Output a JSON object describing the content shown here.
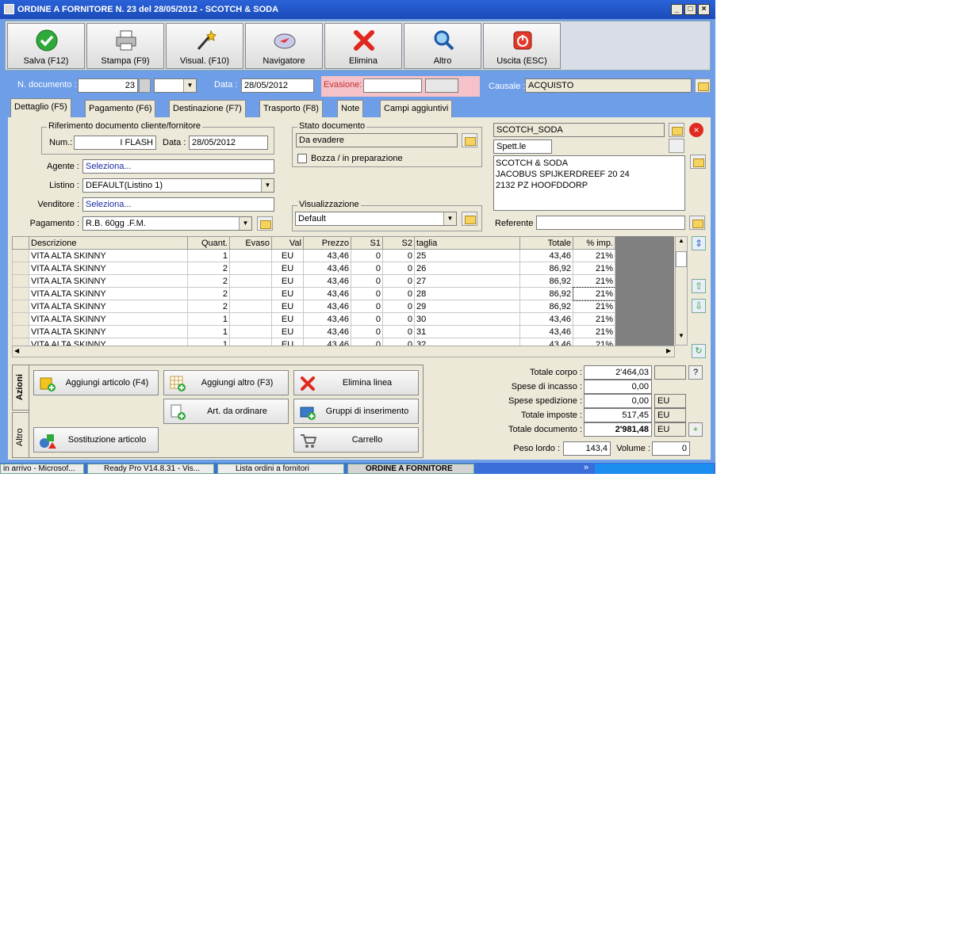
{
  "window": {
    "title": "ORDINE A FORNITORE N. 23  del 28/05/2012 - SCOTCH & SODA"
  },
  "toolbar": [
    {
      "label": "Salva (F12)",
      "icon": "check-icon"
    },
    {
      "label": "Stampa (F9)",
      "icon": "printer-icon"
    },
    {
      "label": "Visual. (F10)",
      "icon": "wand-icon"
    },
    {
      "label": "Navigatore",
      "icon": "compass-icon"
    },
    {
      "label": "Elimina",
      "icon": "delete-x-icon"
    },
    {
      "label": "Altro",
      "icon": "search-icon"
    },
    {
      "label": "Uscita (ESC)",
      "icon": "power-icon"
    }
  ],
  "header": {
    "ndoc_label": "N. documento :",
    "ndoc_value": "23",
    "data_label": "Data :",
    "data_value": "28/05/2012",
    "evasione_label": "Evasione:",
    "evasione_value": "",
    "causale_label": "Causale :",
    "causale_value": "ACQUISTO"
  },
  "tabs": [
    "Dettaglio (F5)",
    "Pagamento (F6)",
    "Destinazione (F7)",
    "Trasporto (F8)",
    "Note",
    "Campi aggiuntivi"
  ],
  "riferimento": {
    "legend": "Riferimento documento cliente/fornitore",
    "num_label": "Num.:",
    "num_value": "I FLASH",
    "data_label": "Data :",
    "data_value": "28/05/2012"
  },
  "form": {
    "agente_label": "Agente :",
    "agente_value": "Seleziona...",
    "listino_label": "Listino :",
    "listino_value": "DEFAULT(Listino 1)",
    "venditore_label": "Venditore :",
    "venditore_value": "Seleziona...",
    "pagamento_label": "Pagamento :",
    "pagamento_value": "R.B. 60gg .F.M."
  },
  "stato": {
    "legend": "Stato documento",
    "value": "Da evadere",
    "bozza_label": "Bozza / in preparazione"
  },
  "visualizzazione": {
    "legend": "Visualizzazione",
    "value": "Default"
  },
  "fornitore": {
    "code": "SCOTCH_SODA",
    "title": "Spett.le",
    "address": [
      "SCOTCH & SODA",
      "JACOBUS SPIJKERDREEF 20 24",
      "2132 PZ HOOFDDORP"
    ],
    "referente_label": "Referente",
    "referente_value": ""
  },
  "grid": {
    "columns": [
      "Descrizione",
      "Quant.",
      "Evaso",
      "Val",
      "Prezzo",
      "S1",
      "S2",
      "taglia",
      "Totale",
      "% imp."
    ],
    "rows": [
      [
        "VITA ALTA SKINNY",
        "1",
        "",
        "EU",
        "43,46",
        "0",
        "0",
        "25",
        "43,46",
        "21%"
      ],
      [
        "VITA ALTA SKINNY",
        "2",
        "",
        "EU",
        "43,46",
        "0",
        "0",
        "26",
        "86,92",
        "21%"
      ],
      [
        "VITA ALTA SKINNY",
        "2",
        "",
        "EU",
        "43,46",
        "0",
        "0",
        "27",
        "86,92",
        "21%"
      ],
      [
        "VITA ALTA SKINNY",
        "2",
        "",
        "EU",
        "43,46",
        "0",
        "0",
        "28",
        "86,92",
        "21%"
      ],
      [
        "VITA ALTA SKINNY",
        "2",
        "",
        "EU",
        "43,46",
        "0",
        "0",
        "29",
        "86,92",
        "21%"
      ],
      [
        "VITA ALTA SKINNY",
        "1",
        "",
        "EU",
        "43,46",
        "0",
        "0",
        "30",
        "43,46",
        "21%"
      ],
      [
        "VITA ALTA SKINNY",
        "1",
        "",
        "EU",
        "43,46",
        "0",
        "0",
        "31",
        "43,46",
        "21%"
      ],
      [
        "VITA ALTA SKINNY",
        "1",
        "",
        "EU",
        "43,46",
        "0",
        "0",
        "32",
        "43,46",
        "21%"
      ]
    ]
  },
  "side_tabs": [
    "Azioni",
    "Altro"
  ],
  "actions": [
    {
      "label": "Aggiungi articolo (F4)",
      "icon": "box-add-icon"
    },
    {
      "label": "Aggiungi altro (F3)",
      "icon": "grid-add-icon"
    },
    {
      "label": "Elimina linea",
      "icon": "delete-x-icon"
    },
    {
      "label": "Art. da ordinare",
      "icon": "doc-add-icon"
    },
    {
      "label": "Gruppi di inserimento",
      "icon": "group-add-icon"
    },
    {
      "label": "Sostituzione articolo",
      "icon": "shapes-icon"
    },
    {
      "label": "Carrello",
      "icon": "cart-icon"
    }
  ],
  "totals": {
    "corpo_label": "Totale corpo :",
    "corpo_value": "2'464,03",
    "incasso_label": "Spese di incasso :",
    "incasso_value": "0,00",
    "spedizione_label": "Spese spedizione :",
    "spedizione_value": "0,00",
    "spedizione_cur": "EU",
    "imposte_label": "Totale imposte :",
    "imposte_value": "517,45",
    "imposte_cur": "EU",
    "documento_label": "Totale documento :",
    "documento_value": "2'981,48",
    "documento_cur": "EU",
    "peso_label": "Peso lordo :",
    "peso_value": "143,4",
    "volume_label": "Volume :",
    "volume_value": "0",
    "help": "?"
  },
  "taskbar": [
    "in arrivo - Microsof...",
    "Ready Pro V14.8.31 - Vis...",
    "Lista ordini a fornitori",
    "ORDINE A FORNITORE"
  ],
  "colors": {
    "titlebar": "#1b4bb8",
    "background": "#6f9ee8",
    "panel": "#ece9d8",
    "evasione_bg": "#f4c2c8"
  }
}
